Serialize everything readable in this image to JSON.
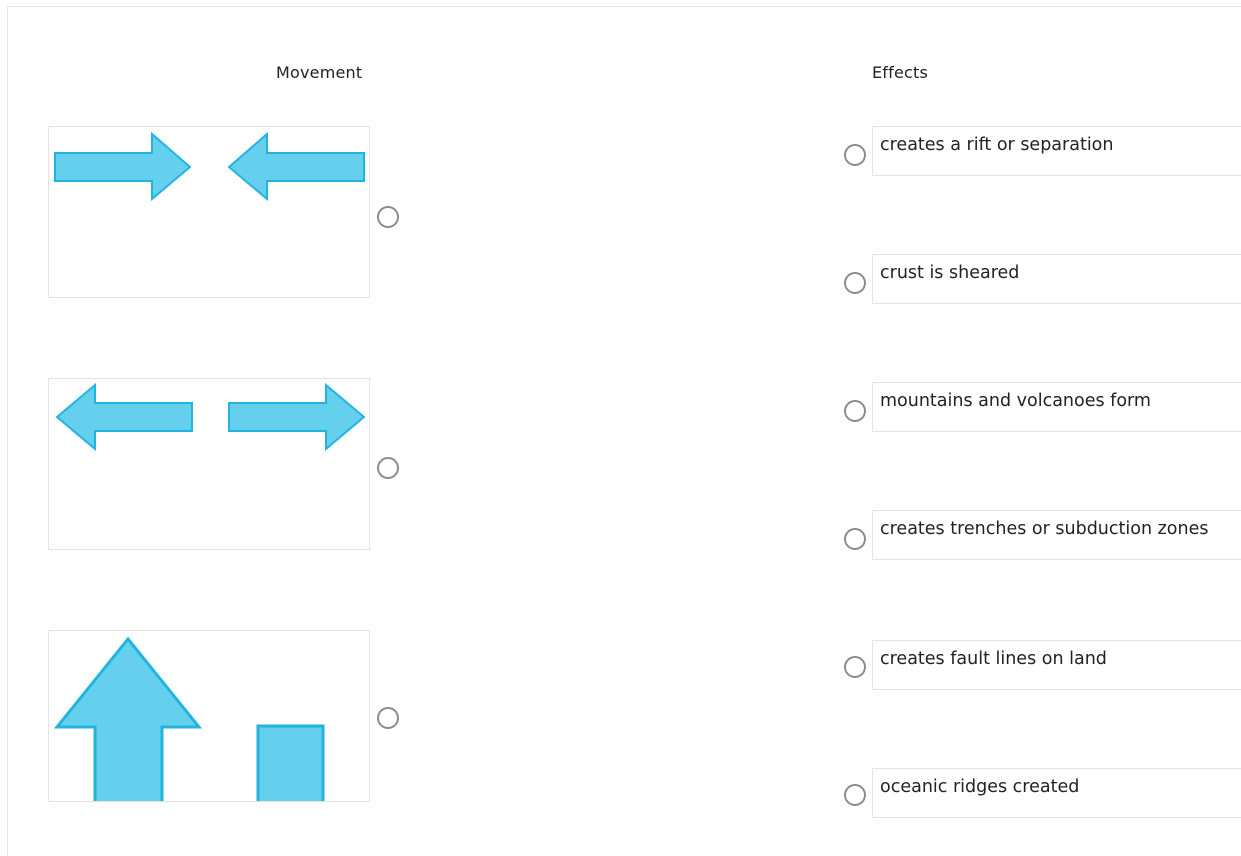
{
  "headers": {
    "movement": "Movement",
    "effects": "Effects"
  },
  "colors": {
    "arrow_fill": "#64d0ee",
    "arrow_stroke": "#23b4de",
    "radio_border": "#8c8c8c"
  },
  "movements": [
    {
      "icon": "converging-arrows-icon"
    },
    {
      "icon": "diverging-arrows-icon"
    },
    {
      "icon": "uplift-arrow-block-icon"
    }
  ],
  "effects": [
    {
      "label": "creates a rift or separation"
    },
    {
      "label": "crust is sheared"
    },
    {
      "label": "mountains and volcanoes form"
    },
    {
      "label": "creates trenches or subduction zones"
    },
    {
      "label": "creates fault lines on land"
    },
    {
      "label": "oceanic ridges created"
    }
  ]
}
